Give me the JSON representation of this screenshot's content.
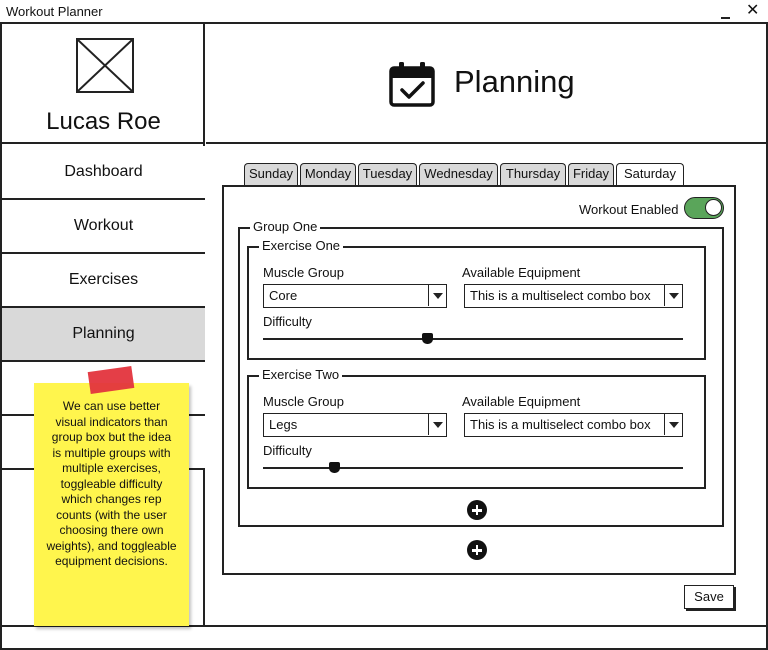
{
  "window": {
    "title": "Workout Planner"
  },
  "sidebar": {
    "user_name": "Lucas Roe",
    "items": [
      {
        "label": "Dashboard",
        "active": false
      },
      {
        "label": "Workout",
        "active": false
      },
      {
        "label": "Exercises",
        "active": false
      },
      {
        "label": "Planning",
        "active": true
      }
    ]
  },
  "header": {
    "title": "Planning",
    "icon": "calendar-check-icon"
  },
  "tabs": [
    {
      "label": "Sunday"
    },
    {
      "label": "Monday"
    },
    {
      "label": "Tuesday"
    },
    {
      "label": "Wednesday"
    },
    {
      "label": "Thursday"
    },
    {
      "label": "Friday"
    },
    {
      "label": "Saturday"
    }
  ],
  "panel": {
    "workout_enabled_label": "Workout Enabled",
    "workout_enabled": true,
    "group": {
      "title": "Group One",
      "exercises": [
        {
          "title": "Exercise One",
          "muscle_group_label": "Muscle Group",
          "muscle_group_value": "Core",
          "equipment_label": "Available Equipment",
          "equipment_value": "This is a multiselect combo box",
          "difficulty_label": "Difficulty",
          "difficulty": 0.39
        },
        {
          "title": "Exercise Two",
          "muscle_group_label": "Muscle Group",
          "muscle_group_value": "Legs",
          "equipment_label": "Available Equipment",
          "equipment_value": "This is a multiselect combo box",
          "difficulty_label": "Difficulty",
          "difficulty": 0.17
        }
      ]
    },
    "save_label": "Save"
  },
  "note": {
    "text": "We can use better visual indicators than group box but the idea is multiple groups with multiple exercises, toggleable difficulty which changes rep counts (with the user choosing there own weights), and toggleable equipment decisions."
  },
  "colors": {
    "active_nav": "#d9d9d9",
    "toggle_on": "#5aa55a",
    "sticky_note": "#fff54d",
    "tape": "#e3343d"
  }
}
